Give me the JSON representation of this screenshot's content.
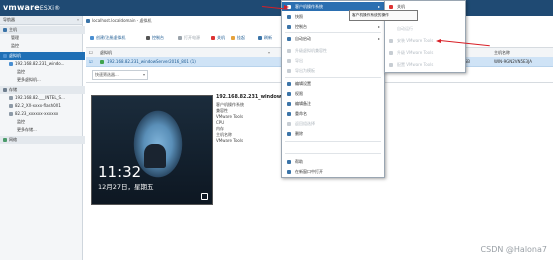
{
  "header": {
    "logo_brand": "vmware",
    "logo_product": "ESXi",
    "logo_mark": "®"
  },
  "nav": {
    "title": "导航器",
    "items": [
      {
        "label": "主机",
        "icon": "host-icon"
      },
      {
        "label": "管理",
        "icon": ""
      },
      {
        "label": "监控",
        "icon": ""
      },
      {
        "label": "虚拟机",
        "icon": "vm-icon"
      },
      {
        "label": "192.168.82.231_windo...",
        "icon": "vm-icon"
      },
      {
        "label": "监控",
        "icon": ""
      },
      {
        "label": "更多虚拟机...",
        "icon": ""
      },
      {
        "label": "存储",
        "icon": "storage-icon"
      },
      {
        "label": "192.168.82.___INTEL_S...",
        "icon": "datastore-icon"
      },
      {
        "label": "82.2_XX-xxxx-flash0X1",
        "icon": "datastore-icon"
      },
      {
        "label": "82.23_xxxxxx-xxxxxx",
        "icon": "datastore-icon"
      },
      {
        "label": "监控",
        "icon": ""
      },
      {
        "label": "更多存储...",
        "icon": ""
      },
      {
        "label": "网络",
        "icon": "network-icon"
      }
    ]
  },
  "breadcrumb": "localhost.localdomain - 虚拟机",
  "toolbar": {
    "buttons": [
      {
        "label": "创建/注册虚拟机",
        "disabled": false
      },
      {
        "label": "控制台",
        "disabled": false
      },
      {
        "label": "打开电源",
        "disabled": true
      },
      {
        "label": "关机",
        "disabled": false
      },
      {
        "label": "挂起",
        "disabled": false
      },
      {
        "label": "刷新",
        "disabled": false
      }
    ]
  },
  "grid": {
    "col_name": "虚拟机",
    "col_host": "主机名称",
    "row_name": "192.168.82.231_windowServer2016_801 (1)",
    "row_mem": "0.64 GB",
    "row_host": "WIN-9GN2VN5E3JA"
  },
  "quick_filter": "快速筛选器...",
  "preview": {
    "time": "11:32",
    "date": "12月27日，星期五"
  },
  "vm": {
    "title": "192.168.82.231_windowServer2016_801(1)",
    "details": [
      {
        "label": "客户机操作系统"
      },
      {
        "label": "兼容性"
      },
      {
        "label": "VMware Tools"
      },
      {
        "label": "CPU"
      },
      {
        "label": "内存"
      },
      {
        "label": "主机名称"
      },
      {
        "label": "VMware Tools"
      }
    ]
  },
  "context_menu": {
    "items": [
      {
        "label": "客户机操作系统",
        "icon": "guest-os-icon",
        "highlight": true,
        "arrow": true,
        "disabled": false
      },
      {
        "label": "快照",
        "icon": "snapshot-icon",
        "arrow": true,
        "disabled": false
      },
      {
        "label": "控制台",
        "icon": "console-icon",
        "arrow": true,
        "disabled": false
      },
      {
        "label": "自动启动",
        "icon": "autostart-icon",
        "arrow": true,
        "disabled": false
      },
      {
        "label": "升级虚拟机兼容性",
        "icon": "upgrade-icon",
        "arrow": false,
        "disabled": true
      },
      {
        "label": "导出",
        "icon": "export-icon",
        "arrow": false,
        "disabled": true
      },
      {
        "label": "导出为模板",
        "icon": "export-template-icon",
        "arrow": false,
        "disabled": true
      },
      {
        "label": "编辑设置",
        "icon": "edit-icon",
        "arrow": false,
        "disabled": false
      },
      {
        "label": "权限",
        "icon": "permissions-icon",
        "arrow": false,
        "disabled": false
      },
      {
        "label": "编辑备注",
        "icon": "notes-icon",
        "arrow": false,
        "disabled": false
      },
      {
        "label": "重命名",
        "icon": "rename-icon",
        "arrow": false,
        "disabled": false
      },
      {
        "label": "返回组选择",
        "icon": "answer-icon",
        "arrow": false,
        "disabled": true
      },
      {
        "label": "删除",
        "icon": "delete-icon",
        "arrow": false,
        "disabled": false
      },
      {
        "label": "帮助",
        "icon": "help-icon",
        "arrow": false,
        "disabled": false
      },
      {
        "label": "在新窗口中打开",
        "icon": "new-window-icon",
        "arrow": false,
        "disabled": false
      }
    ]
  },
  "submenu": {
    "items": [
      {
        "label": "关机",
        "icon": "shutdown-icon",
        "disabled": false
      },
      {
        "label": "重新引导",
        "icon": "restart-icon",
        "disabled": false
      },
      {
        "label": "自动运行",
        "icon": "",
        "disabled": true
      },
      {
        "label": "安装 VMware Tools",
        "icon": "install-tools-icon",
        "disabled": true
      },
      {
        "label": "升级 VMware Tools",
        "icon": "upgrade-tools-icon",
        "disabled": true
      },
      {
        "label": "配置 VMware Tools",
        "icon": "configure-tools-icon",
        "disabled": true
      }
    ]
  },
  "tooltip": "客户机操作系统的操作",
  "watermark": "CSDN @Halona7",
  "colors": {
    "header": "#1f4a73",
    "selected": "#1f6fb5",
    "highlight": "#2b6fb1",
    "arrow": "#d81f26"
  }
}
